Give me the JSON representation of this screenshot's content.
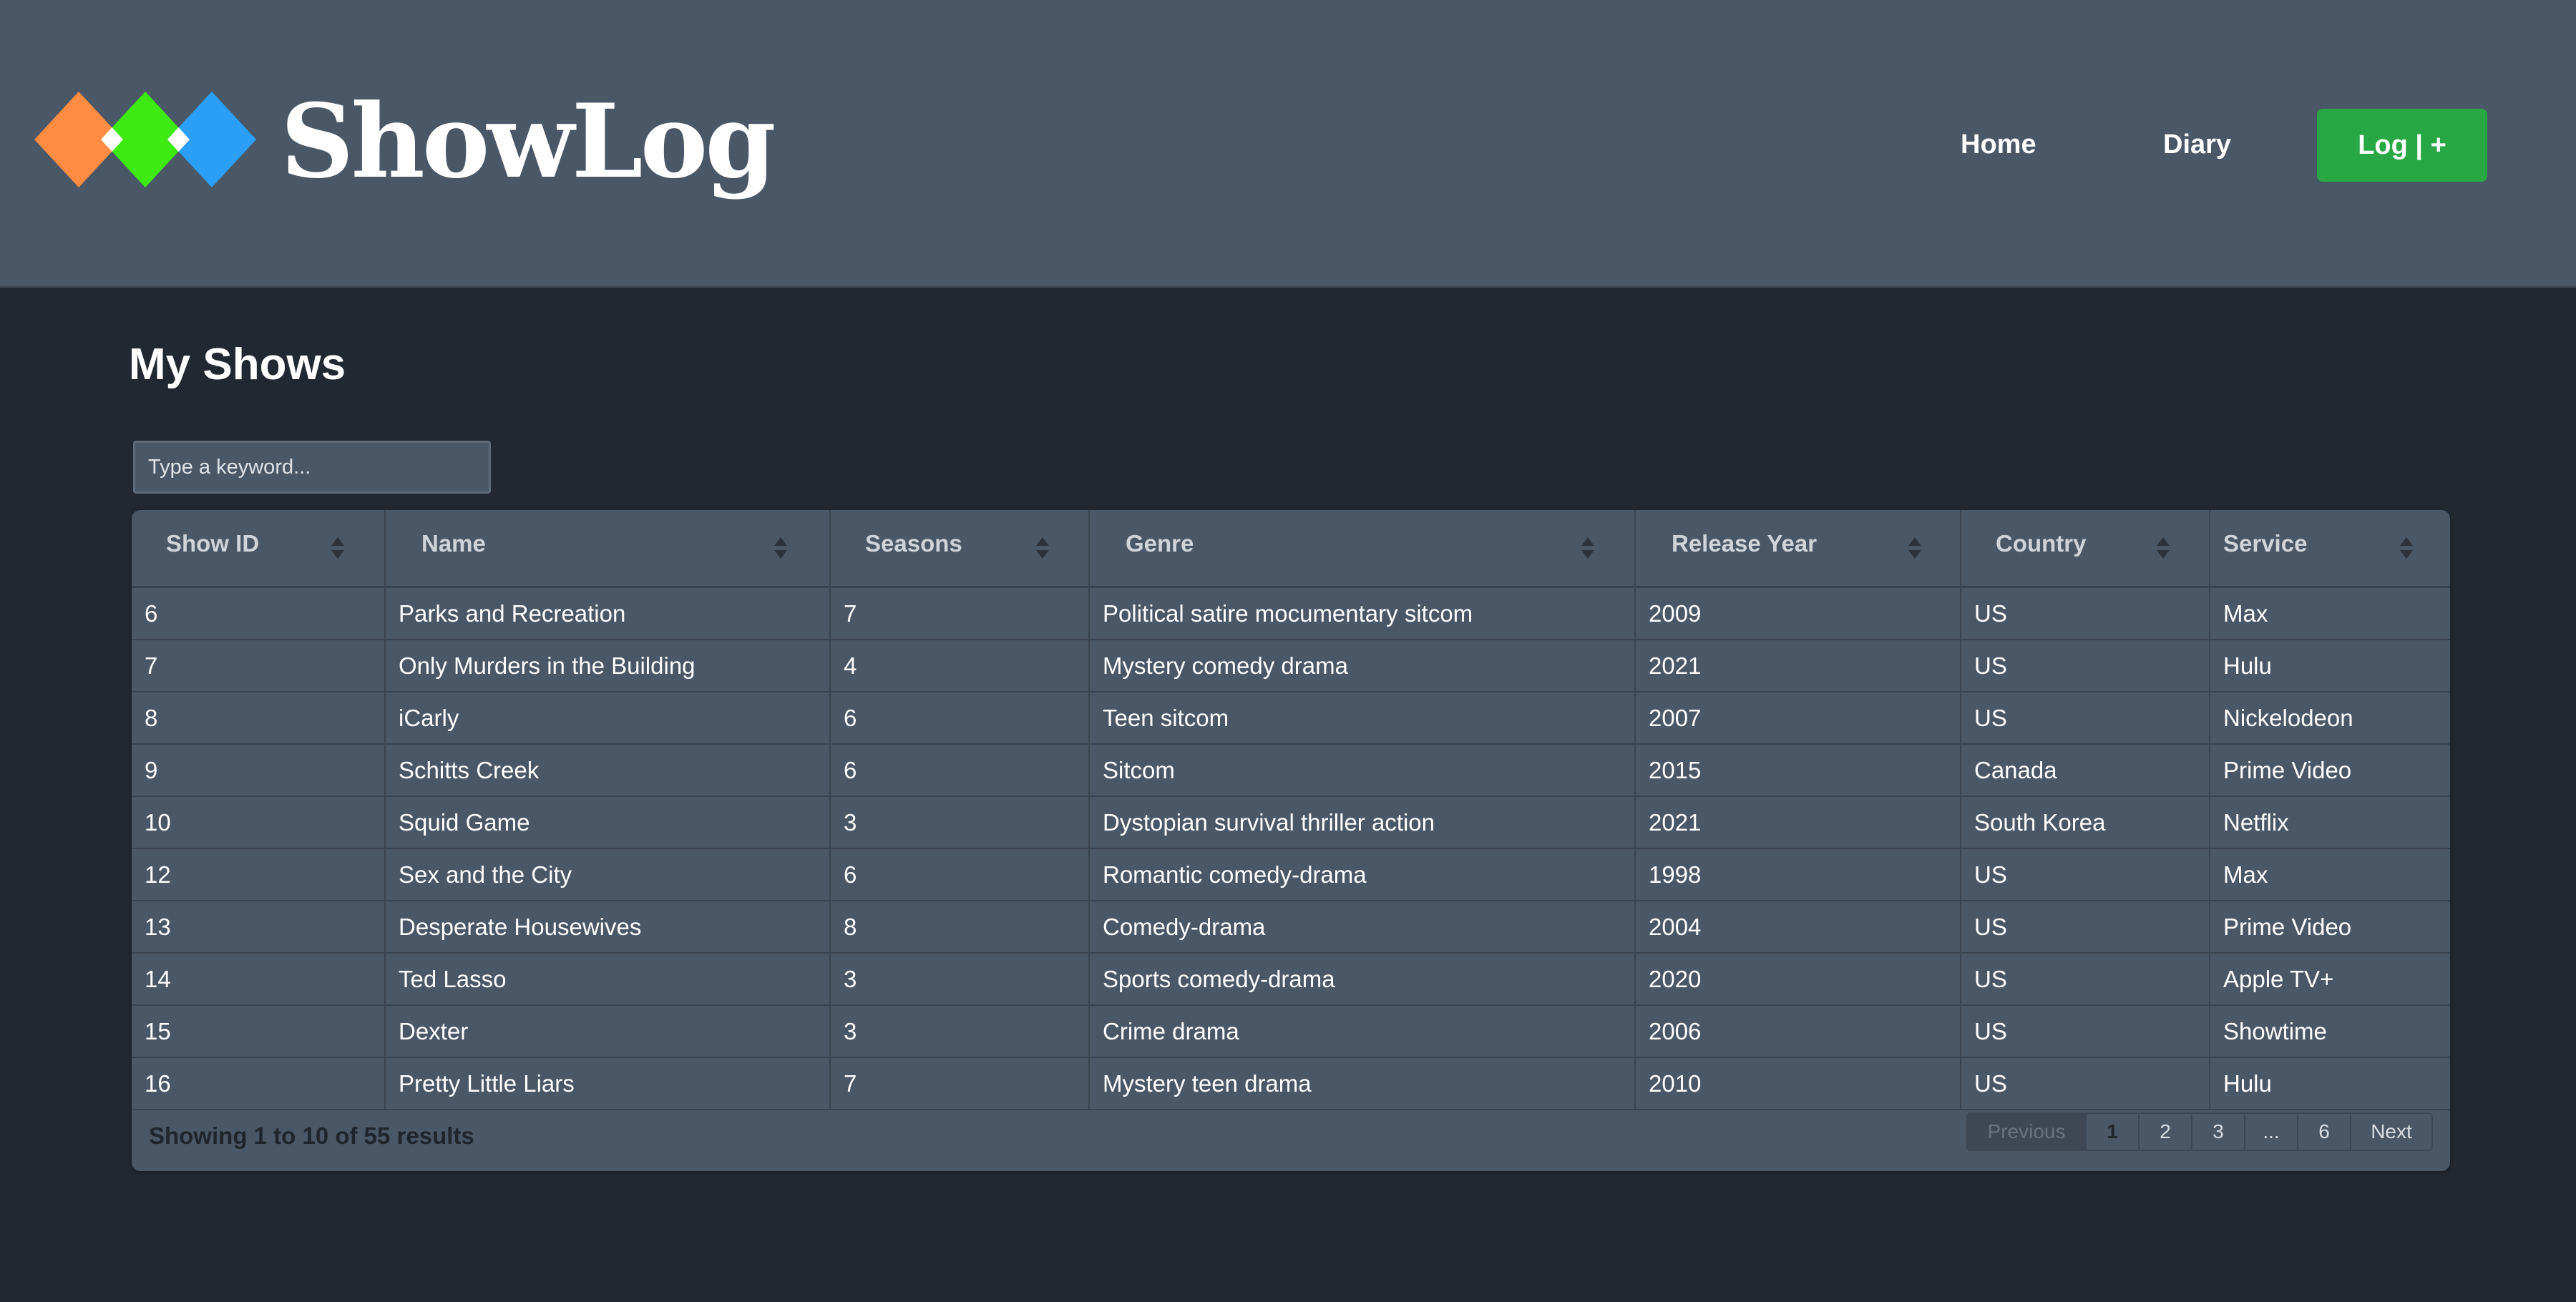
{
  "header": {
    "brand": "ShowLog",
    "logo_colors": [
      "#ff8c42",
      "#3dea11",
      "#2a9ff5"
    ],
    "nav": {
      "home": "Home",
      "diary": "Diary"
    },
    "log_button": "Log | +"
  },
  "page": {
    "title": "My Shows"
  },
  "search": {
    "placeholder": "Type a keyword..."
  },
  "table": {
    "columns": [
      "Show ID",
      "Name",
      "Seasons",
      "Genre",
      "Release Year",
      "Country",
      "Service"
    ],
    "rows": [
      [
        "6",
        "Parks and Recreation",
        "7",
        "Political satire mocumentary sitcom",
        "2009",
        "US",
        "Max"
      ],
      [
        "7",
        "Only Murders in the Building",
        "4",
        "Mystery comedy drama",
        "2021",
        "US",
        "Hulu"
      ],
      [
        "8",
        "iCarly",
        "6",
        "Teen sitcom",
        "2007",
        "US",
        "Nickelodeon"
      ],
      [
        "9",
        "Schitts Creek",
        "6",
        "Sitcom",
        "2015",
        "Canada",
        "Prime Video"
      ],
      [
        "10",
        "Squid Game",
        "3",
        "Dystopian survival thriller action",
        "2021",
        "South Korea",
        "Netflix"
      ],
      [
        "12",
        "Sex and the City",
        "6",
        "Romantic comedy-drama",
        "1998",
        "US",
        "Max"
      ],
      [
        "13",
        "Desperate Housewives",
        "8",
        "Comedy-drama",
        "2004",
        "US",
        "Prime Video"
      ],
      [
        "14",
        "Ted Lasso",
        "3",
        "Sports comedy-drama",
        "2020",
        "US",
        "Apple TV+"
      ],
      [
        "15",
        "Dexter",
        "3",
        "Crime drama",
        "2006",
        "US",
        "Showtime"
      ],
      [
        "16",
        "Pretty Little Liars",
        "7",
        "Mystery teen drama",
        "2010",
        "US",
        "Hulu"
      ]
    ]
  },
  "footer": {
    "info": "Showing 1 to 10 of 55 results",
    "pagination": {
      "previous": "Previous",
      "pages": [
        "1",
        "2",
        "3",
        "...",
        "6"
      ],
      "current": "1",
      "next": "Next"
    }
  }
}
